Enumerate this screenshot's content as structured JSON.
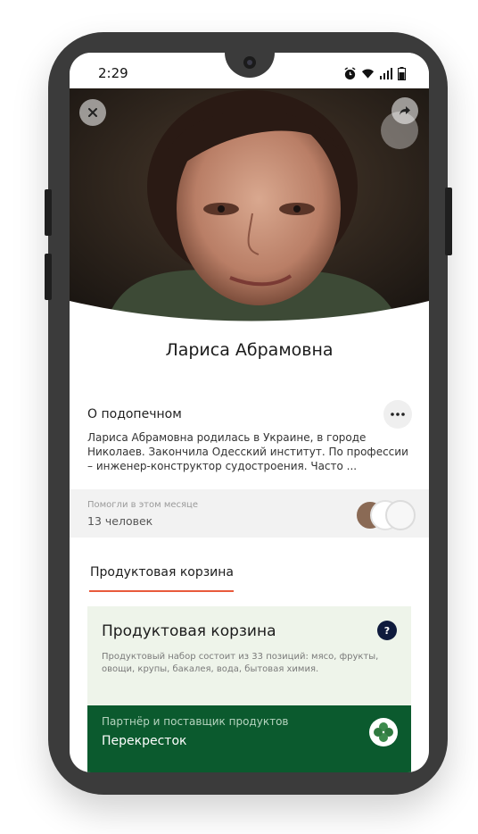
{
  "status_bar": {
    "time": "2:29",
    "icons": [
      "alarm-icon",
      "wifi-icon",
      "signal-icon",
      "battery-icon"
    ]
  },
  "hero": {
    "close_icon": "close-icon",
    "share_icon": "share-icon"
  },
  "profile": {
    "name": "Лариса Абрамовна"
  },
  "about": {
    "title": "О подопечном",
    "text": "Лариса Абрамовна родилась в Украине, в городе Николаев. Закончила Одесский институт. По профессии – инженер-конструктор судостроения. Часто ...",
    "more_icon": "more-icon"
  },
  "helped": {
    "label": "Помогли в этом месяце",
    "count": "13 человек"
  },
  "tabs": [
    {
      "label": "Продуктовая корзина",
      "active": true
    }
  ],
  "basket": {
    "title": "Продуктовая корзина",
    "help": "?",
    "description": "Продуктовый набор состоит из 33 позиций: мясо, фрукты, овощи, крупы, бакалея, вода, бытовая химия."
  },
  "partner": {
    "label": "Партнёр и поставщик продуктов",
    "name": "Перекресток"
  },
  "colors": {
    "accent": "#e85a3c",
    "partner_bg": "#0b5a2e",
    "basket_bg": "#eef4ea",
    "help_icon_bg": "#0f1b3d"
  }
}
